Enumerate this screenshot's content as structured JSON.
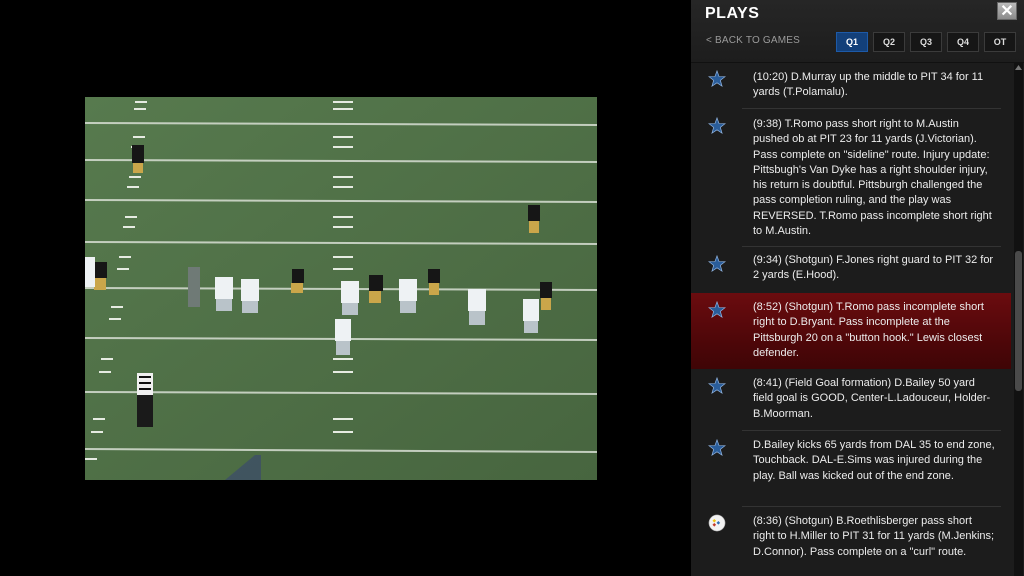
{
  "panel": {
    "title": "PLAYS",
    "close_glyph": "✕",
    "back_label": "< BACK TO GAMES",
    "quarters": [
      {
        "label": "Q1",
        "active": true
      },
      {
        "label": "Q2",
        "active": false
      },
      {
        "label": "Q3",
        "active": false
      },
      {
        "label": "Q4",
        "active": false
      },
      {
        "label": "OT",
        "active": false
      }
    ]
  },
  "plays": [
    {
      "team_icon": "cowboys-star-icon",
      "active": false,
      "text": "(10:20) D.Murray up the middle to PIT 34 for 11 yards (T.Polamalu)."
    },
    {
      "team_icon": "cowboys-star-icon",
      "active": false,
      "text": "(9:38) T.Romo pass short right to M.Austin pushed ob at PIT 23 for 11 yards (J.Victorian). Pass complete on \"sideline\" route. Injury update: Pittsbugh's Van Dyke has a right shoulder injury, his return is doubtful. Pittsburgh challenged the pass completion ruling, and the play was REVERSED. T.Romo pass incomplete short right to M.Austin."
    },
    {
      "team_icon": "cowboys-star-icon",
      "active": false,
      "text": "(9:34) (Shotgun) F.Jones right guard to PIT 32 for 2 yards (E.Hood)."
    },
    {
      "team_icon": "cowboys-star-icon",
      "active": true,
      "text": "(8:52) (Shotgun) T.Romo pass incomplete short right to D.Bryant. Pass incomplete at the Pittsburgh 20 on a \"button hook.\" Lewis closest defender."
    },
    {
      "team_icon": "cowboys-star-icon",
      "active": false,
      "text": "(8:41) (Field Goal formation) D.Bailey 50 yard field goal is GOOD, Center-L.Ladouceur, Holder-B.Moorman."
    },
    {
      "team_icon": "cowboys-star-icon",
      "active": false,
      "text": "D.Bailey kicks 65 yards from DAL 35 to end zone, Touchback. DAL-E.Sims was injured during the play.  Ball was kicked out of the end zone."
    },
    {
      "team_icon": "steelers-logo-icon",
      "active": false,
      "text": "(8:36) (Shotgun) B.Roethlisberger pass short right to H.Miller to PIT 31 for 11 yards (M.Jenkins; D.Connor). Pass complete on a \"curl\" route."
    }
  ],
  "colors": {
    "panel_bg": "#1c1c1c",
    "active_row": "#5a090c",
    "active_tab": "#13407a",
    "star_blue": "#2a5d9a",
    "field_green": "#4f6e47"
  }
}
